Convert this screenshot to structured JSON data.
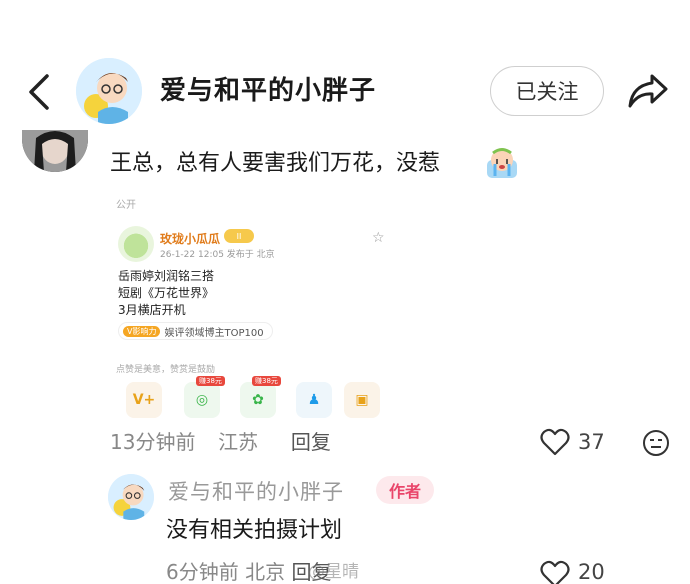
{
  "header": {
    "back_icon": "chevron-left-icon",
    "author_name": "爱与和平的小胖子",
    "follow_label": "已关注",
    "share_icon": "share-arrow-icon"
  },
  "comment": {
    "text": "王总，总有人要害我们万花，没惹",
    "emoji": "crying-face-emoji",
    "embedded_post": {
      "visibility": "公开",
      "author": "玫珑小瓜瓜",
      "level_badge": "II",
      "meta": "26-1-22 12:05  发布于 北京",
      "lines": [
        "岳雨婷刘润铭三搭",
        "短剧《万花世界》",
        "3月横店开机"
      ],
      "tag_prefix": "V影响力",
      "tag": "娱评领域博主TOP100",
      "like_hint": "点赞是美意，赞赏是鼓励",
      "share_badges": [
        "赚38元",
        "赚38元"
      ]
    },
    "time": "13分钟前",
    "location": "江苏",
    "reply_label": "回复",
    "like_count": "37"
  },
  "reply": {
    "author_name": "爱与和平的小胖子",
    "author_badge": "作者",
    "text": "没有相关拍摄计划",
    "time": "6分钟前",
    "location": "北京",
    "reply_label": "回复",
    "like_count": "20",
    "watermark": "@星晴"
  },
  "colors": {
    "author_badge_bg": "#fde9ec",
    "author_badge_text": "#e9456a",
    "embed_author": "#e07b1a"
  }
}
